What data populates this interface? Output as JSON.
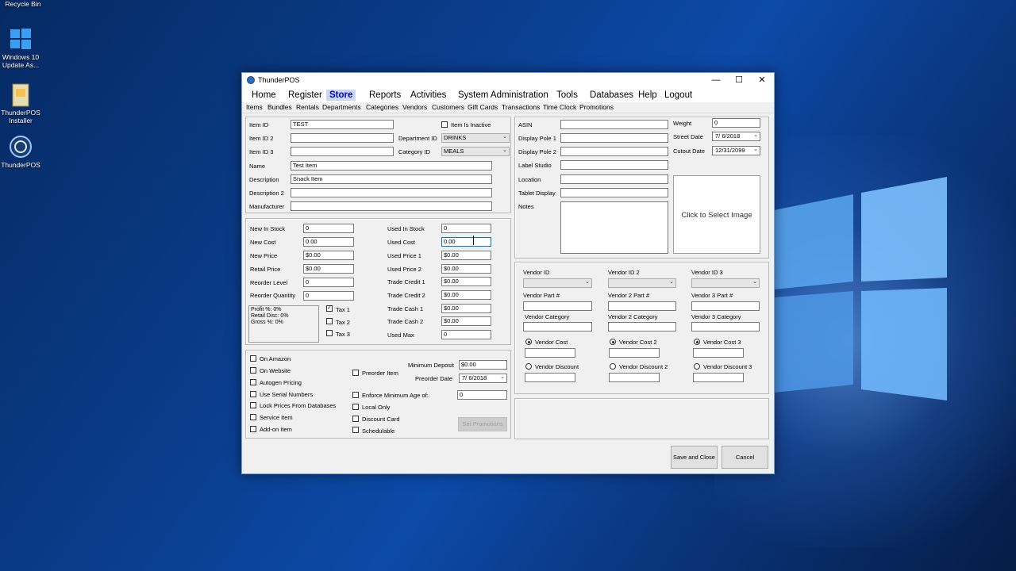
{
  "desktop": {
    "icons": [
      {
        "label": "Recycle Bin"
      },
      {
        "label": "Windows 10 Update As..."
      },
      {
        "label": "ThunderPOS Installer"
      },
      {
        "label": "ThunderPOS"
      }
    ]
  },
  "window": {
    "title": "ThunderPOS",
    "controls": {
      "minimize": "—",
      "maximize": "☐",
      "close": "✕"
    }
  },
  "menu": [
    "Home",
    "Register",
    "Store",
    "Reports",
    "Activities",
    "System Administration",
    "Tools",
    "Databases",
    "Help",
    "Logout"
  ],
  "menu_active": "Store",
  "submenu": [
    "Items",
    "Bundles",
    "Rentals",
    "Departments",
    "Categories",
    "Vendors",
    "Customers",
    "Gift Cards",
    "Transactions",
    "Time Clock",
    "Promotions"
  ],
  "item": {
    "item_id_label": "Item ID",
    "item_id": "TEST",
    "item_id2_label": "Item ID 2",
    "item_id2": "",
    "item_id3_label": "Item ID 3",
    "item_id3": "",
    "inactive_label": "Item Is Inactive",
    "department_label": "Department ID",
    "department": "DRINKS",
    "category_label": "Category ID",
    "category": "MEALS",
    "name_label": "Name",
    "name": "Test Item",
    "description_label": "Description",
    "description": "Snack Item",
    "description2_label": "Description 2",
    "description2": "",
    "manufacturer_label": "Manufacturer",
    "manufacturer": ""
  },
  "pricing": {
    "new_in_stock_label": "New In Stock",
    "new_in_stock": "0",
    "new_cost_label": "New Cost",
    "new_cost": "0.00",
    "new_price_label": "New Price",
    "new_price": "$0.00",
    "retail_price_label": "Retail Price",
    "retail_price": "$0.00",
    "reorder_level_label": "Reorder Level",
    "reorder_level": "0",
    "reorder_qty_label": "Reorder Quantity",
    "reorder_qty": "0",
    "used_in_stock_label": "Used In Stock",
    "used_in_stock": "0",
    "used_cost_label": "Used Cost",
    "used_cost": "0.00",
    "used_price1_label": "Used Price 1",
    "used_price1": "$0.00",
    "used_price2_label": "Used Price 2",
    "used_price2": "$0.00",
    "trade_credit1_label": "Trade Credit 1",
    "trade_credit1": "$0.00",
    "trade_credit2_label": "Trade Credit 2",
    "trade_credit2": "$0.00",
    "trade_cash1_label": "Trade Cash 1",
    "trade_cash1": "$0.00",
    "trade_cash2_label": "Trade Cash 2",
    "trade_cash2": "$0.00",
    "used_max_label": "Used Max",
    "used_max": "0",
    "stats": [
      "Profit %: 0%",
      "Retail Disc: 0%",
      "Gross %: 0%"
    ],
    "tax1_label": "Tax 1",
    "tax1_checked": true,
    "tax2_label": "Tax 2",
    "tax2_checked": false,
    "tax3_label": "Tax 3",
    "tax3_checked": false
  },
  "options": {
    "left": [
      "On Amazon",
      "On Website",
      "Autogen Pricing",
      "Use Serial Numbers",
      "Lock Prices From Databases",
      "Service Item",
      "Add-on Item"
    ],
    "preorder_label": "Preorder Item",
    "min_deposit_label": "Minimum Deposit",
    "min_deposit": "$0.00",
    "preorder_date_label": "Preorder Date",
    "preorder_date": "7/  6/2018",
    "enforce_age_label": "Enforce Minimum Age of:",
    "enforce_age": "0",
    "local_only_label": "Local Only",
    "discount_card_label": "Discount Card",
    "schedulable_label": "Schedulable",
    "set_promotions_label": "Set Promotions"
  },
  "online": {
    "asin_label": "ASIN",
    "asin": "",
    "display_pole1_label": "Display Pole 1",
    "display_pole1": "",
    "display_pole2_label": "Display Pole 2",
    "display_pole2": "",
    "label_studio_label": "Label Studio",
    "label_studio": "",
    "location_label": "Location",
    "location": "",
    "tablet_display_label": "Tablet Display",
    "tablet_display": "",
    "notes_label": "Notes",
    "notes": "",
    "weight_label": "Weight",
    "weight": "0",
    "street_date_label": "Street Date",
    "street_date": "7/  6/2018",
    "cutout_date_label": "Cutout Date",
    "cutout_date": "12/31/2099",
    "image_placeholder": "Click to Select Image"
  },
  "vendors": {
    "id_labels": [
      "Vendor ID",
      "Vendor ID 2",
      "Vendor ID 3"
    ],
    "part_labels": [
      "Vendor Part #",
      "Vendor 2 Part #",
      "Vendor 3 Part #"
    ],
    "category_labels": [
      "Vendor Category",
      "Vendor 2 Category",
      "Vendor 3 Category"
    ],
    "cost_labels": [
      "Vendor Cost",
      "Vendor Cost 2",
      "Vendor Cost 3"
    ],
    "discount_labels": [
      "Vendor Discount",
      "Vendor Discount 2",
      "Vendor Discount 3"
    ]
  },
  "footer": {
    "save_close": "Save and Close",
    "cancel": "Cancel"
  }
}
